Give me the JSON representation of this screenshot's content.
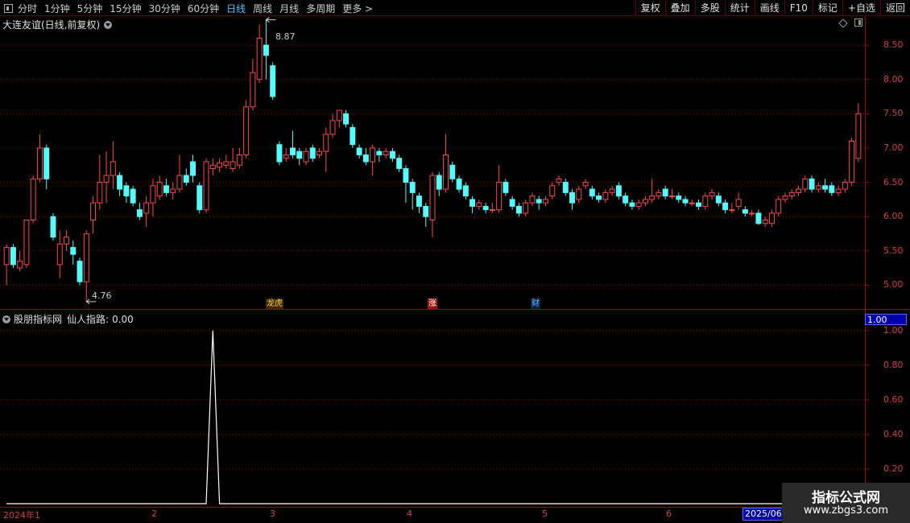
{
  "toolbar": {
    "periods": [
      "分时",
      "1分钟",
      "5分钟",
      "15分钟",
      "30分钟",
      "60分钟",
      "日线",
      "周线",
      "月线",
      "多周期",
      "更多 >"
    ],
    "active_period": "日线",
    "right_buttons": [
      "复权",
      "叠加",
      "多股",
      "统计",
      "画线",
      "F10",
      "标记",
      "+自选",
      "返回"
    ]
  },
  "main_chart": {
    "title": "大连友谊(日线,前复权)",
    "y_axis_labels": [
      "8.50",
      "8.00",
      "7.50",
      "7.00",
      "6.50",
      "6.00",
      "5.50",
      "5.00"
    ],
    "high_label": "8.87",
    "low_label": "4.76",
    "tags": [
      "龙虎",
      "涨",
      "财"
    ],
    "colors": {
      "up": "#ff4848",
      "down": "#54fcfc",
      "grid": "#8b0000"
    }
  },
  "indicator": {
    "title": "股朋指标网",
    "name": "仙人指路:",
    "value": "0.00",
    "current_value": "1.00",
    "y_axis_labels": [
      "1.00",
      "0.80",
      "0.60",
      "0.40",
      "0.20"
    ]
  },
  "date_axis": {
    "labels": [
      "2024年1",
      "2",
      "3",
      "4",
      "5",
      "6"
    ],
    "current": "2025/06/"
  },
  "watermark": {
    "line1": "指标公式网",
    "line2": "www.zbgs3.com"
  },
  "chart_data": {
    "type": "candlestick",
    "ylim": [
      4.7,
      8.9
    ],
    "candles": [
      {
        "o": 5.3,
        "c": 5.55,
        "h": 5.6,
        "l": 5.0
      },
      {
        "o": 5.55,
        "c": 5.3,
        "h": 5.6,
        "l": 5.25
      },
      {
        "o": 5.25,
        "c": 5.35,
        "h": 5.5,
        "l": 5.2
      },
      {
        "o": 5.3,
        "c": 5.95,
        "h": 5.95,
        "l": 5.25
      },
      {
        "o": 5.95,
        "c": 6.55,
        "h": 6.6,
        "l": 5.9
      },
      {
        "o": 6.55,
        "c": 7.0,
        "h": 7.2,
        "l": 6.5
      },
      {
        "o": 7.0,
        "c": 6.55,
        "h": 7.05,
        "l": 6.4
      },
      {
        "o": 6.0,
        "c": 5.7,
        "h": 6.05,
        "l": 5.65
      },
      {
        "o": 5.3,
        "c": 5.6,
        "h": 5.8,
        "l": 5.1
      },
      {
        "o": 5.6,
        "c": 5.7,
        "h": 5.8,
        "l": 5.5
      },
      {
        "o": 5.55,
        "c": 5.45,
        "h": 5.65,
        "l": 5.3
      },
      {
        "o": 5.35,
        "c": 5.05,
        "h": 5.4,
        "l": 5.0
      },
      {
        "o": 5.05,
        "c": 5.75,
        "h": 5.8,
        "l": 4.76
      },
      {
        "o": 5.95,
        "c": 6.2,
        "h": 6.3,
        "l": 5.75
      },
      {
        "o": 6.2,
        "c": 6.5,
        "h": 6.9,
        "l": 6.1
      },
      {
        "o": 6.5,
        "c": 6.6,
        "h": 6.95,
        "l": 6.2
      },
      {
        "o": 6.6,
        "c": 6.8,
        "h": 7.1,
        "l": 6.4
      },
      {
        "o": 6.6,
        "c": 6.4,
        "h": 6.65,
        "l": 6.3
      },
      {
        "o": 6.45,
        "c": 6.3,
        "h": 6.5,
        "l": 6.2
      },
      {
        "o": 6.4,
        "c": 6.2,
        "h": 6.45,
        "l": 6.15
      },
      {
        "o": 6.1,
        "c": 6.0,
        "h": 6.2,
        "l": 5.95
      },
      {
        "o": 6.05,
        "c": 6.2,
        "h": 6.3,
        "l": 5.85
      },
      {
        "o": 6.2,
        "c": 6.45,
        "h": 6.55,
        "l": 6.0
      },
      {
        "o": 6.3,
        "c": 6.5,
        "h": 6.6,
        "l": 6.25
      },
      {
        "o": 6.45,
        "c": 6.35,
        "h": 6.55,
        "l": 6.3
      },
      {
        "o": 6.35,
        "c": 6.4,
        "h": 6.5,
        "l": 6.25
      },
      {
        "o": 6.4,
        "c": 6.6,
        "h": 6.9,
        "l": 6.35
      },
      {
        "o": 6.6,
        "c": 6.5,
        "h": 6.7,
        "l": 6.45
      },
      {
        "o": 6.8,
        "c": 6.6,
        "h": 6.9,
        "l": 6.5
      },
      {
        "o": 6.45,
        "c": 6.1,
        "h": 6.5,
        "l": 6.05
      },
      {
        "o": 6.1,
        "c": 6.8,
        "h": 6.85,
        "l": 6.05
      },
      {
        "o": 6.7,
        "c": 6.75,
        "h": 6.85,
        "l": 6.6
      },
      {
        "o": 6.72,
        "c": 6.78,
        "h": 6.85,
        "l": 6.65
      },
      {
        "o": 6.75,
        "c": 6.8,
        "h": 6.9,
        "l": 6.7
      },
      {
        "o": 6.7,
        "c": 6.8,
        "h": 7.0,
        "l": 6.65
      },
      {
        "o": 6.75,
        "c": 6.9,
        "h": 7.0,
        "l": 6.7
      },
      {
        "o": 6.9,
        "c": 7.6,
        "h": 7.7,
        "l": 6.85
      },
      {
        "o": 7.6,
        "c": 8.1,
        "h": 8.3,
        "l": 7.55
      },
      {
        "o": 8.0,
        "c": 8.6,
        "h": 8.8,
        "l": 7.95
      },
      {
        "o": 8.5,
        "c": 8.35,
        "h": 8.87,
        "l": 8.0
      },
      {
        "o": 8.2,
        "c": 7.75,
        "h": 8.25,
        "l": 7.7
      },
      {
        "o": 7.05,
        "c": 6.8,
        "h": 7.1,
        "l": 6.75
      },
      {
        "o": 6.85,
        "c": 6.9,
        "h": 7.0,
        "l": 6.8
      },
      {
        "o": 7.0,
        "c": 6.9,
        "h": 7.25,
        "l": 6.85
      },
      {
        "o": 6.95,
        "c": 6.85,
        "h": 7.0,
        "l": 6.75
      },
      {
        "o": 6.8,
        "c": 6.95,
        "h": 7.0,
        "l": 6.75
      },
      {
        "o": 7.0,
        "c": 6.85,
        "h": 7.05,
        "l": 6.8
      },
      {
        "o": 6.9,
        "c": 6.95,
        "h": 7.0,
        "l": 6.85
      },
      {
        "o": 6.95,
        "c": 7.2,
        "h": 7.3,
        "l": 6.65
      },
      {
        "o": 7.2,
        "c": 7.4,
        "h": 7.5,
        "l": 7.15
      },
      {
        "o": 7.4,
        "c": 7.55,
        "h": 7.55,
        "l": 7.3
      },
      {
        "o": 7.5,
        "c": 7.35,
        "h": 7.55,
        "l": 7.3
      },
      {
        "o": 7.3,
        "c": 7.05,
        "h": 7.35,
        "l": 7.0
      },
      {
        "o": 7.0,
        "c": 6.9,
        "h": 7.05,
        "l": 6.85
      },
      {
        "o": 6.9,
        "c": 6.8,
        "h": 7.0,
        "l": 6.75
      },
      {
        "o": 6.8,
        "c": 7.0,
        "h": 7.05,
        "l": 6.6
      },
      {
        "o": 6.95,
        "c": 6.9,
        "h": 7.0,
        "l": 6.8
      },
      {
        "o": 6.9,
        "c": 6.95,
        "h": 7.0,
        "l": 6.85
      },
      {
        "o": 6.95,
        "c": 6.85,
        "h": 7.0,
        "l": 6.8
      },
      {
        "o": 6.85,
        "c": 6.7,
        "h": 6.9,
        "l": 6.65
      },
      {
        "o": 6.7,
        "c": 6.5,
        "h": 6.75,
        "l": 6.2
      },
      {
        "o": 6.5,
        "c": 6.35,
        "h": 6.55,
        "l": 6.1
      },
      {
        "o": 6.3,
        "c": 6.15,
        "h": 6.35,
        "l": 6.05
      },
      {
        "o": 6.15,
        "c": 6.0,
        "h": 6.2,
        "l": 5.85
      },
      {
        "o": 5.95,
        "c": 6.6,
        "h": 6.65,
        "l": 5.7
      },
      {
        "o": 6.6,
        "c": 6.4,
        "h": 6.65,
        "l": 6.3
      },
      {
        "o": 6.4,
        "c": 6.9,
        "h": 7.2,
        "l": 6.35
      },
      {
        "o": 6.75,
        "c": 6.55,
        "h": 6.8,
        "l": 6.5
      },
      {
        "o": 6.55,
        "c": 6.4,
        "h": 6.6,
        "l": 6.35
      },
      {
        "o": 6.45,
        "c": 6.3,
        "h": 6.5,
        "l": 6.25
      },
      {
        "o": 6.25,
        "c": 6.15,
        "h": 6.3,
        "l": 6.05
      },
      {
        "o": 6.15,
        "c": 6.2,
        "h": 6.25,
        "l": 6.1
      },
      {
        "o": 6.15,
        "c": 6.1,
        "h": 6.2,
        "l": 6.05
      },
      {
        "o": 6.1,
        "c": 6.1,
        "h": 6.2,
        "l": 6.05
      },
      {
        "o": 6.1,
        "c": 6.5,
        "h": 6.75,
        "l": 6.05
      },
      {
        "o": 6.5,
        "c": 6.35,
        "h": 6.55,
        "l": 6.3
      },
      {
        "o": 6.25,
        "c": 6.15,
        "h": 6.3,
        "l": 6.1
      },
      {
        "o": 6.15,
        "c": 6.05,
        "h": 6.2,
        "l": 6.0
      },
      {
        "o": 6.05,
        "c": 6.2,
        "h": 6.25,
        "l": 6.0
      },
      {
        "o": 6.2,
        "c": 6.3,
        "h": 6.35,
        "l": 6.15
      },
      {
        "o": 6.25,
        "c": 6.2,
        "h": 6.3,
        "l": 6.1
      },
      {
        "o": 6.2,
        "c": 6.25,
        "h": 6.3,
        "l": 6.15
      },
      {
        "o": 6.3,
        "c": 6.45,
        "h": 6.5,
        "l": 6.25
      },
      {
        "o": 6.5,
        "c": 6.55,
        "h": 6.6,
        "l": 6.45
      },
      {
        "o": 6.5,
        "c": 6.35,
        "h": 6.55,
        "l": 6.3
      },
      {
        "o": 6.35,
        "c": 6.2,
        "h": 6.4,
        "l": 6.1
      },
      {
        "o": 6.25,
        "c": 6.4,
        "h": 6.45,
        "l": 6.2
      },
      {
        "o": 6.45,
        "c": 6.5,
        "h": 6.55,
        "l": 6.4
      },
      {
        "o": 6.4,
        "c": 6.3,
        "h": 6.45,
        "l": 6.25
      },
      {
        "o": 6.3,
        "c": 6.25,
        "h": 6.35,
        "l": 6.2
      },
      {
        "o": 6.25,
        "c": 6.35,
        "h": 6.4,
        "l": 6.2
      },
      {
        "o": 6.35,
        "c": 6.4,
        "h": 6.45,
        "l": 6.3
      },
      {
        "o": 6.45,
        "c": 6.3,
        "h": 6.5,
        "l": 6.25
      },
      {
        "o": 6.3,
        "c": 6.2,
        "h": 6.35,
        "l": 6.15
      },
      {
        "o": 6.2,
        "c": 6.15,
        "h": 6.25,
        "l": 6.1
      },
      {
        "o": 6.15,
        "c": 6.2,
        "h": 6.25,
        "l": 6.1
      },
      {
        "o": 6.2,
        "c": 6.25,
        "h": 6.3,
        "l": 6.15
      },
      {
        "o": 6.25,
        "c": 6.3,
        "h": 6.55,
        "l": 6.2
      },
      {
        "o": 6.3,
        "c": 6.35,
        "h": 6.4,
        "l": 6.25
      },
      {
        "o": 6.4,
        "c": 6.3,
        "h": 6.45,
        "l": 6.25
      },
      {
        "o": 6.3,
        "c": 6.3,
        "h": 6.4,
        "l": 6.25
      },
      {
        "o": 6.3,
        "c": 6.25,
        "h": 6.35,
        "l": 6.2
      },
      {
        "o": 6.25,
        "c": 6.2,
        "h": 6.3,
        "l": 6.15
      },
      {
        "o": 6.2,
        "c": 6.2,
        "h": 6.25,
        "l": 6.15
      },
      {
        "o": 6.2,
        "c": 6.15,
        "h": 6.25,
        "l": 6.1
      },
      {
        "o": 6.15,
        "c": 6.3,
        "h": 6.35,
        "l": 6.1
      },
      {
        "o": 6.3,
        "c": 6.35,
        "h": 6.4,
        "l": 6.25
      },
      {
        "o": 6.3,
        "c": 6.2,
        "h": 6.35,
        "l": 6.15
      },
      {
        "o": 6.2,
        "c": 6.1,
        "h": 6.25,
        "l": 6.05
      },
      {
        "o": 6.1,
        "c": 6.1,
        "h": 6.2,
        "l": 6.05
      },
      {
        "o": 6.15,
        "c": 6.25,
        "h": 6.35,
        "l": 6.1
      },
      {
        "o": 6.1,
        "c": 6.05,
        "h": 6.15,
        "l": 6.0
      },
      {
        "o": 6.05,
        "c": 6.05,
        "h": 6.1,
        "l": 6.0
      },
      {
        "o": 6.05,
        "c": 5.9,
        "h": 6.1,
        "l": 5.88
      },
      {
        "o": 5.9,
        "c": 5.95,
        "h": 6.0,
        "l": 5.85
      },
      {
        "o": 5.9,
        "c": 6.05,
        "h": 6.1,
        "l": 5.85
      },
      {
        "o": 6.05,
        "c": 6.25,
        "h": 6.3,
        "l": 6.0
      },
      {
        "o": 6.25,
        "c": 6.3,
        "h": 6.35,
        "l": 6.2
      },
      {
        "o": 6.3,
        "c": 6.35,
        "h": 6.4,
        "l": 6.25
      },
      {
        "o": 6.35,
        "c": 6.4,
        "h": 6.45,
        "l": 6.3
      },
      {
        "o": 6.4,
        "c": 6.55,
        "h": 6.6,
        "l": 6.35
      },
      {
        "o": 6.55,
        "c": 6.4,
        "h": 6.6,
        "l": 6.35
      },
      {
        "o": 6.4,
        "c": 6.45,
        "h": 6.5,
        "l": 6.35
      },
      {
        "o": 6.45,
        "c": 6.4,
        "h": 6.55,
        "l": 6.35
      },
      {
        "o": 6.45,
        "c": 6.35,
        "h": 6.5,
        "l": 6.3
      },
      {
        "o": 6.35,
        "c": 6.4,
        "h": 6.45,
        "l": 6.3
      },
      {
        "o": 6.4,
        "c": 6.5,
        "h": 6.55,
        "l": 6.35
      },
      {
        "o": 6.5,
        "c": 7.1,
        "h": 7.15,
        "l": 6.45
      },
      {
        "o": 6.85,
        "c": 7.5,
        "h": 7.65,
        "l": 6.8
      }
    ],
    "indicator_series": {
      "name": "仙人指路",
      "values": [
        0,
        0,
        0,
        0,
        0,
        0,
        0,
        0,
        0,
        0,
        0,
        0,
        0,
        0,
        0,
        0,
        0,
        0,
        0,
        0,
        0,
        0,
        0,
        0,
        0,
        0,
        0,
        0,
        0,
        0,
        0,
        1,
        0,
        0,
        0,
        0,
        0,
        0,
        0,
        0,
        0,
        0,
        0,
        0,
        0,
        0,
        0,
        0,
        0,
        0,
        0,
        0,
        0,
        0,
        0,
        0,
        0,
        0,
        0,
        0,
        0,
        0,
        0,
        0,
        0,
        0,
        0,
        0,
        0,
        0,
        0,
        0,
        0,
        0,
        0,
        0,
        0,
        0,
        0,
        0,
        0,
        0,
        0,
        0,
        0,
        0,
        0,
        0,
        0,
        0,
        0,
        0,
        0,
        0,
        0,
        0,
        0,
        0,
        0,
        0,
        0,
        0,
        0,
        0,
        0,
        0,
        0,
        0,
        0,
        0,
        0,
        0,
        0,
        0,
        0,
        0,
        0,
        0,
        0,
        0,
        0,
        0,
        0,
        0,
        0,
        0,
        0,
        0,
        0,
        0,
        0,
        0,
        0,
        0,
        0,
        0,
        0,
        0,
        0,
        0,
        0,
        0,
        0,
        0,
        0,
        0,
        0,
        0,
        0,
        0,
        0,
        0,
        0,
        0,
        0,
        0,
        0,
        0,
        0,
        0,
        0,
        0,
        0,
        0,
        0,
        0,
        0,
        0,
        0,
        0,
        0,
        0,
        0,
        0,
        0,
        0,
        0,
        0,
        0,
        0
      ]
    },
    "indicator_ylim": [
      0,
      1.05
    ]
  }
}
